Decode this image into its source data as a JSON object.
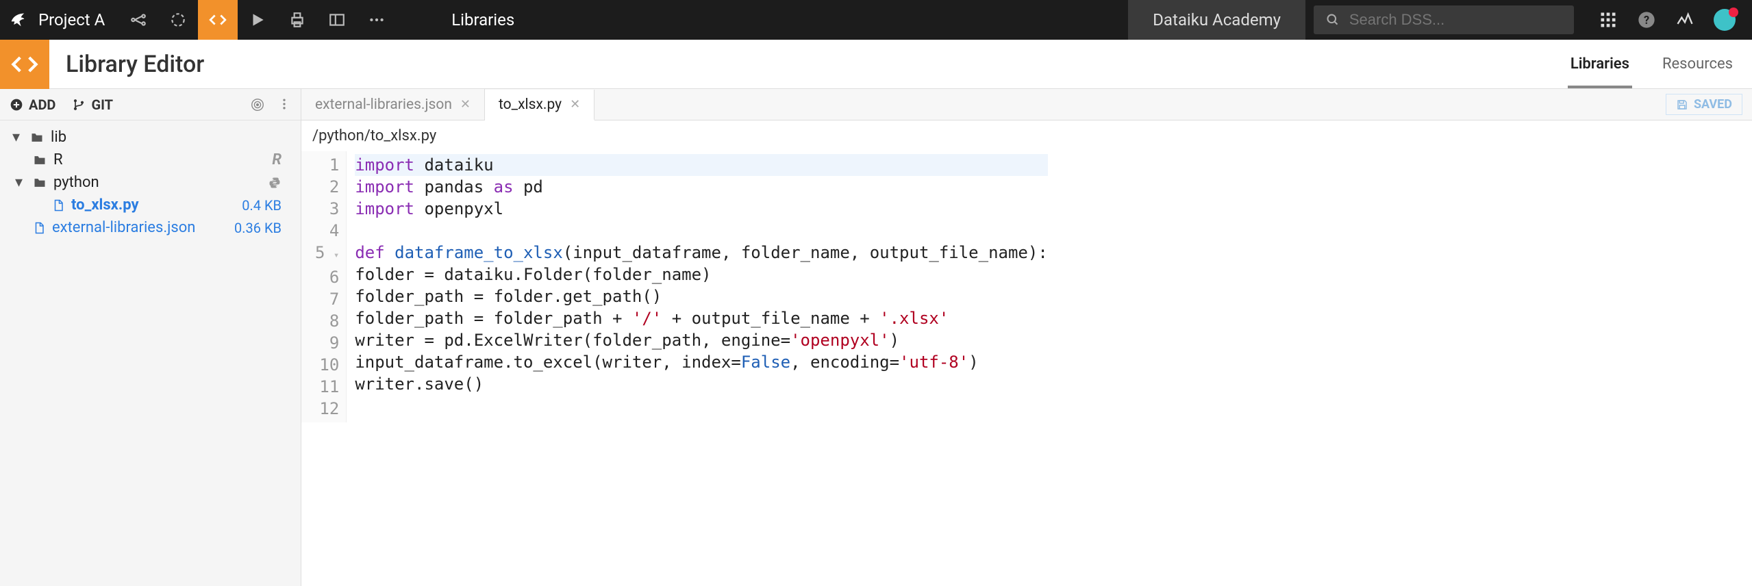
{
  "top": {
    "project": "Project A",
    "tab_primary": "Libraries",
    "tab_secondary": "Dataiku Academy",
    "search_placeholder": "Search DSS..."
  },
  "subheader": {
    "title": "Library Editor",
    "tabs": [
      "Libraries",
      "Resources"
    ],
    "active_tab": 0
  },
  "sidebar": {
    "add_label": "ADD",
    "git_label": "GIT",
    "tree": {
      "root": "lib",
      "r_folder": "R",
      "python_folder": "python",
      "file_selected": {
        "name": "to_xlsx.py",
        "size": "0.4 KB"
      },
      "file_other": {
        "name": "external-libraries.json",
        "size": "0.36 KB"
      }
    }
  },
  "editor": {
    "tabs": [
      {
        "label": "external-libraries.json",
        "active": false
      },
      {
        "label": "to_xlsx.py",
        "active": true
      }
    ],
    "saved_label": "SAVED",
    "breadcrumb": "/python/to_xlsx.py",
    "code": {
      "lines": [
        {
          "n": 1,
          "tokens": [
            [
              "kw",
              "import"
            ],
            [
              "sp",
              " "
            ],
            [
              "nm",
              "dataiku"
            ]
          ]
        },
        {
          "n": 2,
          "tokens": [
            [
              "kw",
              "import"
            ],
            [
              "sp",
              " "
            ],
            [
              "nm",
              "pandas "
            ],
            [
              "kw",
              "as"
            ],
            [
              "sp",
              " "
            ],
            [
              "nm",
              "pd"
            ]
          ]
        },
        {
          "n": 3,
          "tokens": [
            [
              "kw",
              "import"
            ],
            [
              "sp",
              " "
            ],
            [
              "nm",
              "openpyxl"
            ]
          ]
        },
        {
          "n": 4,
          "tokens": []
        },
        {
          "n": 5,
          "fold": true,
          "tokens": [
            [
              "kw",
              "def"
            ],
            [
              "sp",
              " "
            ],
            [
              "fn",
              "dataframe_to_xlsx"
            ],
            [
              "nm",
              "(input_dataframe, folder_name, output_file_name):"
            ]
          ]
        },
        {
          "n": 6,
          "tokens": [
            [
              "sp",
              "    "
            ],
            [
              "nm",
              "folder = dataiku.Folder(folder_name)"
            ]
          ]
        },
        {
          "n": 7,
          "tokens": [
            [
              "sp",
              "    "
            ],
            [
              "nm",
              "folder_path = folder.get_path()"
            ]
          ]
        },
        {
          "n": 8,
          "tokens": [
            [
              "sp",
              "    "
            ],
            [
              "nm",
              "folder_path = folder_path + "
            ],
            [
              "str",
              "'/'"
            ],
            [
              "nm",
              " + output_file_name + "
            ],
            [
              "str",
              "'.xlsx'"
            ]
          ]
        },
        {
          "n": 9,
          "tokens": [
            [
              "sp",
              "    "
            ],
            [
              "nm",
              "writer = pd.ExcelWriter(folder_path, engine="
            ],
            [
              "str",
              "'openpyxl'"
            ],
            [
              "nm",
              ")"
            ]
          ]
        },
        {
          "n": 10,
          "tokens": [
            [
              "sp",
              "    "
            ],
            [
              "nm",
              "input_dataframe.to_excel(writer, index="
            ],
            [
              "val",
              "False"
            ],
            [
              "nm",
              ", encoding="
            ],
            [
              "str",
              "'utf-8'"
            ],
            [
              "nm",
              ")"
            ]
          ]
        },
        {
          "n": 11,
          "tokens": [
            [
              "sp",
              "    "
            ],
            [
              "nm",
              "writer.save()"
            ]
          ]
        },
        {
          "n": 12,
          "tokens": []
        }
      ]
    }
  }
}
